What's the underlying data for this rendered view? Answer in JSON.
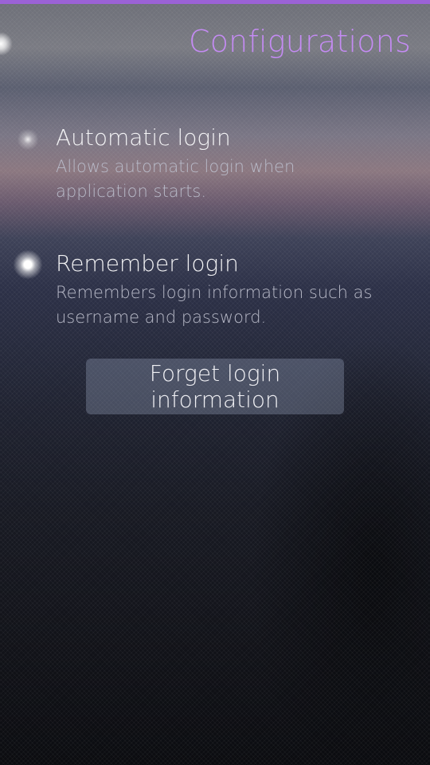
{
  "header": {
    "title": "Configurations"
  },
  "settings": [
    {
      "label": "Automatic login",
      "description": "Allows automatic login when application starts.",
      "checked": false
    },
    {
      "label": "Remember login",
      "description": "Remembers login information such as username and password.",
      "checked": true
    }
  ],
  "actions": {
    "forget_label": "Forget login information"
  },
  "colors": {
    "accent": "#9b62d6",
    "title": "#c48bf3"
  }
}
